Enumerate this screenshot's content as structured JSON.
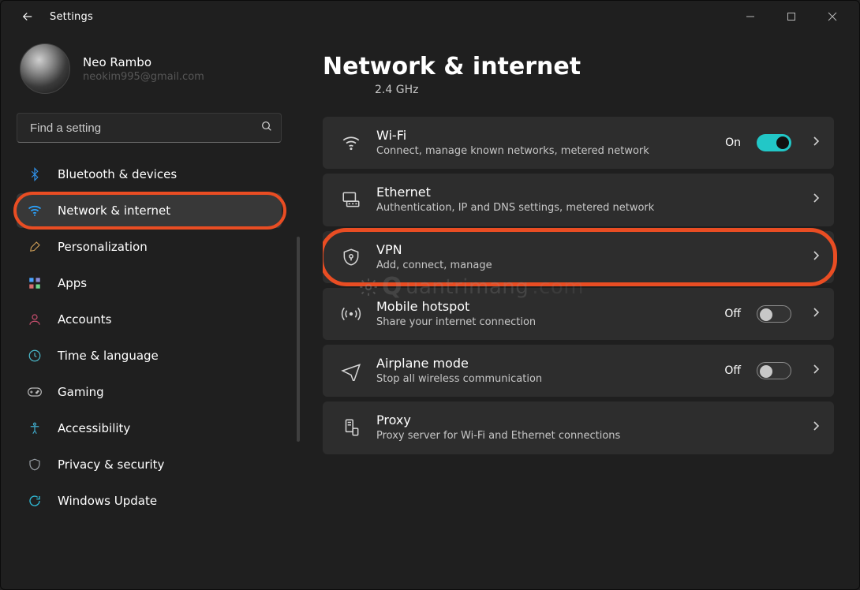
{
  "app_title": "Settings",
  "profile": {
    "name": "Neo Rambo",
    "email": "neokim995@gmail.com"
  },
  "search": {
    "placeholder": "Find a setting"
  },
  "sidebar": {
    "items": [
      {
        "icon": "bluetooth",
        "label": "Bluetooth & devices"
      },
      {
        "icon": "wifi",
        "label": "Network & internet",
        "selected": true,
        "highlight": true
      },
      {
        "icon": "brush",
        "label": "Personalization"
      },
      {
        "icon": "apps",
        "label": "Apps"
      },
      {
        "icon": "account",
        "label": "Accounts"
      },
      {
        "icon": "time",
        "label": "Time & language"
      },
      {
        "icon": "gaming",
        "label": "Gaming"
      },
      {
        "icon": "accessibility",
        "label": "Accessibility"
      },
      {
        "icon": "privacy",
        "label": "Privacy & security"
      },
      {
        "icon": "update",
        "label": "Windows Update"
      }
    ]
  },
  "page": {
    "title": "Network & internet",
    "subline": "2.4 GHz",
    "tiles": [
      {
        "key": "wifi",
        "title": "Wi-Fi",
        "desc": "Connect, manage known networks, metered network",
        "status": "On",
        "toggle": "on"
      },
      {
        "key": "ethernet",
        "title": "Ethernet",
        "desc": "Authentication, IP and DNS settings, metered network"
      },
      {
        "key": "vpn",
        "title": "VPN",
        "desc": "Add, connect, manage",
        "highlight": true
      },
      {
        "key": "hotspot",
        "title": "Mobile hotspot",
        "desc": "Share your internet connection",
        "status": "Off",
        "toggle": "off"
      },
      {
        "key": "airplane",
        "title": "Airplane mode",
        "desc": "Stop all wireless communication",
        "status": "Off",
        "toggle": "off"
      },
      {
        "key": "proxy",
        "title": "Proxy",
        "desc": "Proxy server for Wi-Fi and Ethernet connections"
      }
    ]
  },
  "watermark": "uantrimang"
}
